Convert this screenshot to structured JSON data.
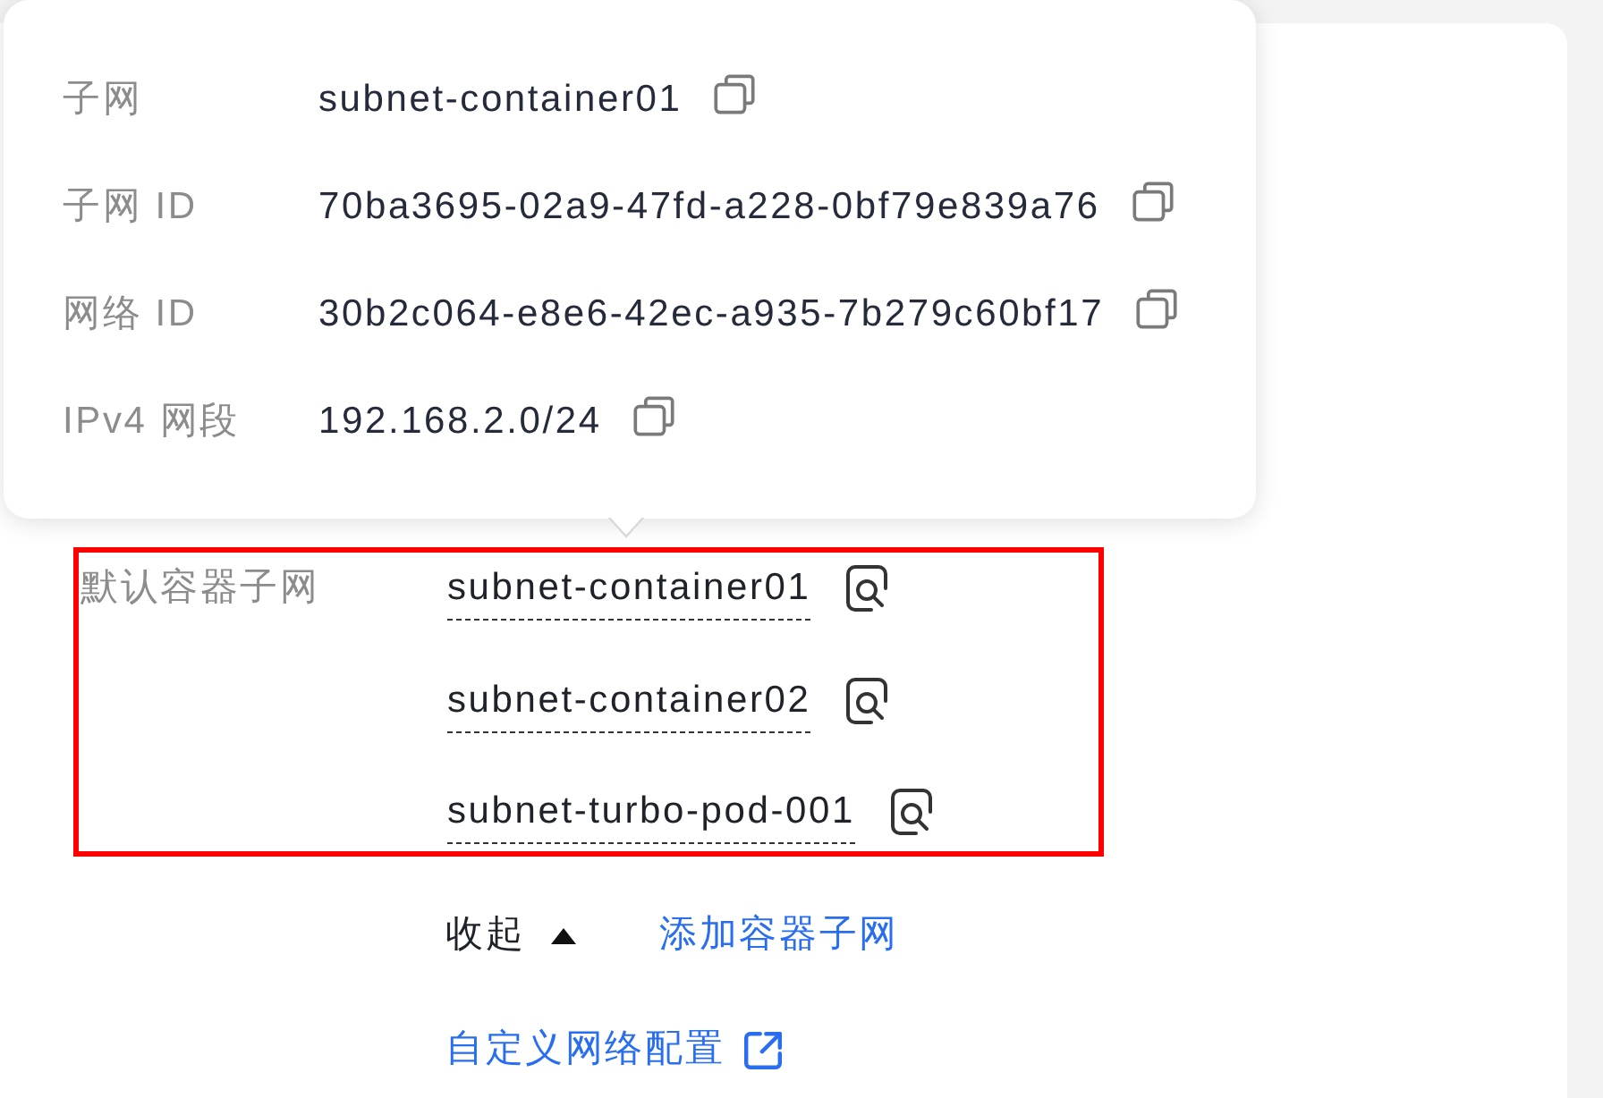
{
  "popover": {
    "rows": [
      {
        "label": "子网",
        "value": "subnet-container01"
      },
      {
        "label": "子网 ID",
        "value": "70ba3695-02a9-47fd-a228-0bf79e839a76"
      },
      {
        "label": "网络 ID",
        "value": "30b2c064-e8e6-42ec-a935-7b279c60bf17"
      },
      {
        "label": "IPv4 网段",
        "value": "192.168.2.0/24"
      }
    ]
  },
  "container_subnets": {
    "label": "默认容器子网",
    "highlighted": true,
    "items": [
      "subnet-container01",
      "subnet-container02",
      "subnet-turbo-pod-001"
    ]
  },
  "toggle": {
    "label": "收起",
    "expanded": true
  },
  "add_link": {
    "label": "添加容器子网"
  },
  "custom_config_link": {
    "label": "自定义网络配置"
  }
}
